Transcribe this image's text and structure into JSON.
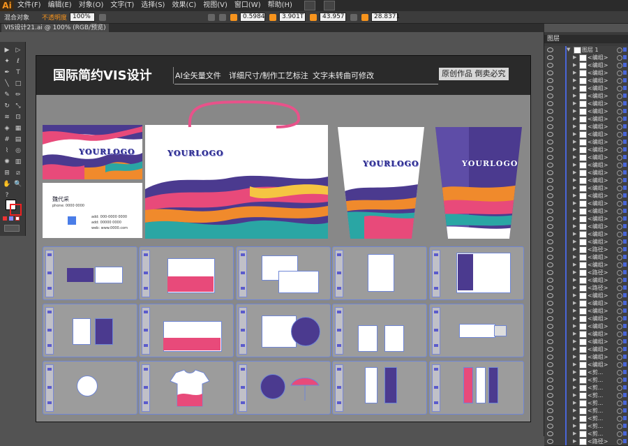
{
  "app": {
    "logo": "Ai"
  },
  "menu": [
    "文件(F)",
    "编辑(E)",
    "对象(O)",
    "文字(T)",
    "选择(S)",
    "效果(C)",
    "视图(V)",
    "窗口(W)",
    "帮助(H)"
  ],
  "control": {
    "selection_label": "混合对象",
    "opacity_label": "不透明度",
    "opacity_value": "100%",
    "x_value": "0.5984",
    "y_value": "3.901T",
    "w_value": "43.957",
    "h_value": "28.8371"
  },
  "document_tab": "VIS设计21.ai @ 100% (RGB/预览)",
  "banner": {
    "title": "国际简约VIS设计",
    "items": [
      "AI全矢量文件",
      "详细尺寸/制作工艺标注",
      "文字未转曲可修改"
    ],
    "badge": "原创作品 倒卖必究"
  },
  "logo_text": "YOURLOGO",
  "business_card": {
    "name": "魏代采",
    "lines": [
      "phone: 0000 0000",
      "add: 000-0000 0000",
      "add: 00000 0000",
      "web: www.0000.com"
    ]
  },
  "layers_panel": {
    "title": "图层",
    "layer_name": "图层 1",
    "rows": [
      "<编组>",
      "<编组>",
      "<编组>",
      "<编组>",
      "<编组>",
      "<编组>",
      "<编组>",
      "<编组>",
      "<编组>",
      "<编组>",
      "<编组>",
      "<编组>",
      "<编组>",
      "<编组>",
      "<编组>",
      "<编组>",
      "<编组>",
      "<编组>",
      "<编组>",
      "<编组>",
      "<编组>",
      "<编组>",
      "<编组>",
      "<编组>",
      "<编组>",
      "<路径>",
      "<编组>",
      "<编组>",
      "<路径>",
      "<编组>",
      "<路径>",
      "<编组>",
      "<编组>",
      "<编组>",
      "<编组>",
      "<编组>",
      "<编组>",
      "<编组>",
      "<编组>",
      "<编组>",
      "<编组>",
      "<剪...",
      "<剪...",
      "<剪...",
      "<剪...",
      "<剪...",
      "<剪...",
      "<剪...",
      "<剪...",
      "<剪...",
      "<路径>"
    ]
  },
  "colors": {
    "accent": "#f7941d",
    "brand_purple": "#4b3a8f",
    "brand_orange": "#f08a2c",
    "brand_pink": "#e84a7a",
    "brand_teal": "#2aa6a4",
    "selection_blue": "#4a66d8"
  }
}
